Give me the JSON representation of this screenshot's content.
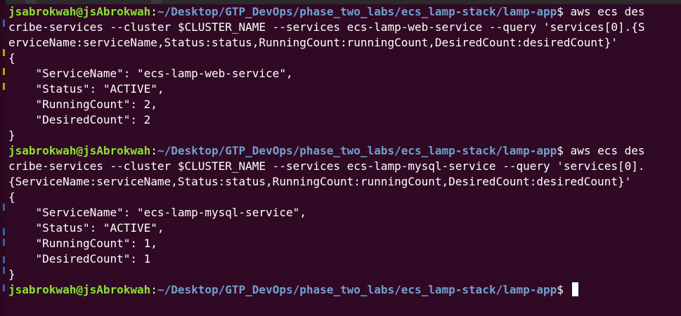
{
  "theme": {
    "bg": "#300a24",
    "user_color": "#8ae234",
    "path_color": "#729fcf",
    "text_color": "#ffffff"
  },
  "prompt": {
    "user_host": "jsabrokwah@jsAbrokwah",
    "sep": ":",
    "path": "~/Desktop/GTP_DevOps/phase_two_labs/ecs_lamp-stack/lamp-app",
    "symbol": "$"
  },
  "lines": [
    {
      "type": "prompt",
      "cmd": " aws ecs des"
    },
    {
      "type": "text",
      "text": "cribe-services --cluster $CLUSTER_NAME --services ecs-lamp-web-service --query 'services[0].{S"
    },
    {
      "type": "text",
      "text": "erviceName:serviceName,Status:status,RunningCount:runningCount,DesiredCount:desiredCount}'"
    },
    {
      "type": "text",
      "text": "{"
    },
    {
      "type": "text",
      "text": "    \"ServiceName\": \"ecs-lamp-web-service\","
    },
    {
      "type": "text",
      "text": "    \"Status\": \"ACTIVE\","
    },
    {
      "type": "text",
      "text": "    \"RunningCount\": 2,"
    },
    {
      "type": "text",
      "text": "    \"DesiredCount\": 2"
    },
    {
      "type": "text",
      "text": "}"
    },
    {
      "type": "prompt",
      "cmd": " aws ecs des"
    },
    {
      "type": "text",
      "text": "cribe-services --cluster $CLUSTER_NAME --services ecs-lamp-mysql-service --query 'services[0]."
    },
    {
      "type": "text",
      "text": "{ServiceName:serviceName,Status:status,RunningCount:runningCount,DesiredCount:desiredCount}'"
    },
    {
      "type": "text",
      "text": "{"
    },
    {
      "type": "text",
      "text": "    \"ServiceName\": \"ecs-lamp-mysql-service\","
    },
    {
      "type": "text",
      "text": "    \"Status\": \"ACTIVE\","
    },
    {
      "type": "text",
      "text": "    \"RunningCount\": 1,"
    },
    {
      "type": "text",
      "text": "    \"DesiredCount\": 1"
    },
    {
      "type": "text",
      "text": "}"
    },
    {
      "type": "prompt",
      "cmd": " ",
      "cursor": true
    }
  ]
}
